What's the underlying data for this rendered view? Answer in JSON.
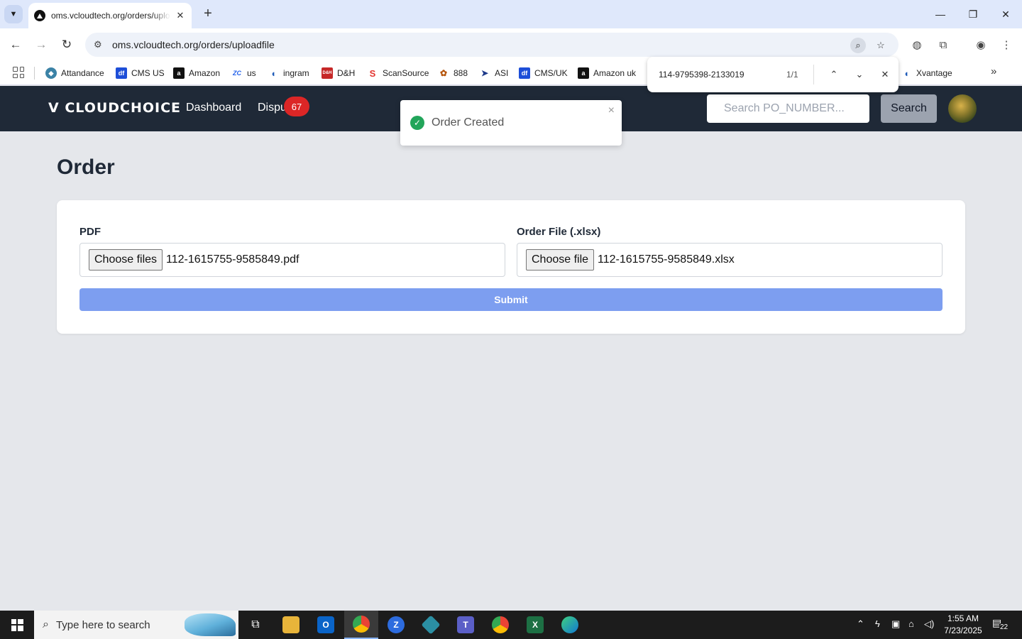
{
  "browser": {
    "tab_title": "oms.vcloudtech.org/orders/uploadfile",
    "url": "oms.vcloudtech.org/orders/uploadfile",
    "bookmarks": [
      {
        "label": "Attandance",
        "color": "#3b82a6"
      },
      {
        "label": "CMS US",
        "color": "#1d4ed8"
      },
      {
        "label": "Amazon",
        "color": "#111111"
      },
      {
        "label": "us",
        "color": "#2563eb"
      },
      {
        "label": "ingram",
        "color": "#1e5bb8"
      },
      {
        "label": "D&H",
        "color": "#c62828"
      },
      {
        "label": "ScanSource",
        "color": "#e3342f"
      },
      {
        "label": "888",
        "color": "#b45309"
      },
      {
        "label": "ASI",
        "color": "#1e3a8a"
      },
      {
        "label": "CMS/UK",
        "color": "#1d4ed8"
      },
      {
        "label": "Amazon uk",
        "color": "#111111"
      },
      {
        "label": "Xvantage",
        "color": "#1e5bb8"
      }
    ],
    "find": {
      "query": "114-9795398-2133019",
      "count": "1/1"
    }
  },
  "app": {
    "logo": "V CLOUDCHOICE",
    "nav": {
      "dashboard": "Dashboard",
      "disputes": "Dispu",
      "badge": "67"
    },
    "search": {
      "placeholder": "Search PO_NUMBER...",
      "button": "Search"
    }
  },
  "toast": {
    "message": "Order Created"
  },
  "page": {
    "title": "Order",
    "pdf": {
      "label": "PDF",
      "button": "Choose files",
      "file": "112-1615755-9585849.pdf"
    },
    "order_file": {
      "label": "Order File (.xlsx)",
      "button": "Choose file",
      "file": "112-1615755-9585849.xlsx"
    },
    "submit": "Submit"
  },
  "taskbar": {
    "search_placeholder": "Type here to search",
    "time": "1:55 AM",
    "date": "7/23/2025",
    "notifications": "22"
  },
  "colors": {
    "navbar": "#1f2937",
    "badge": "#dc2626",
    "submit": "#7d9ef0",
    "page_bg": "#e5e7eb",
    "toast_success": "#22a55a"
  }
}
